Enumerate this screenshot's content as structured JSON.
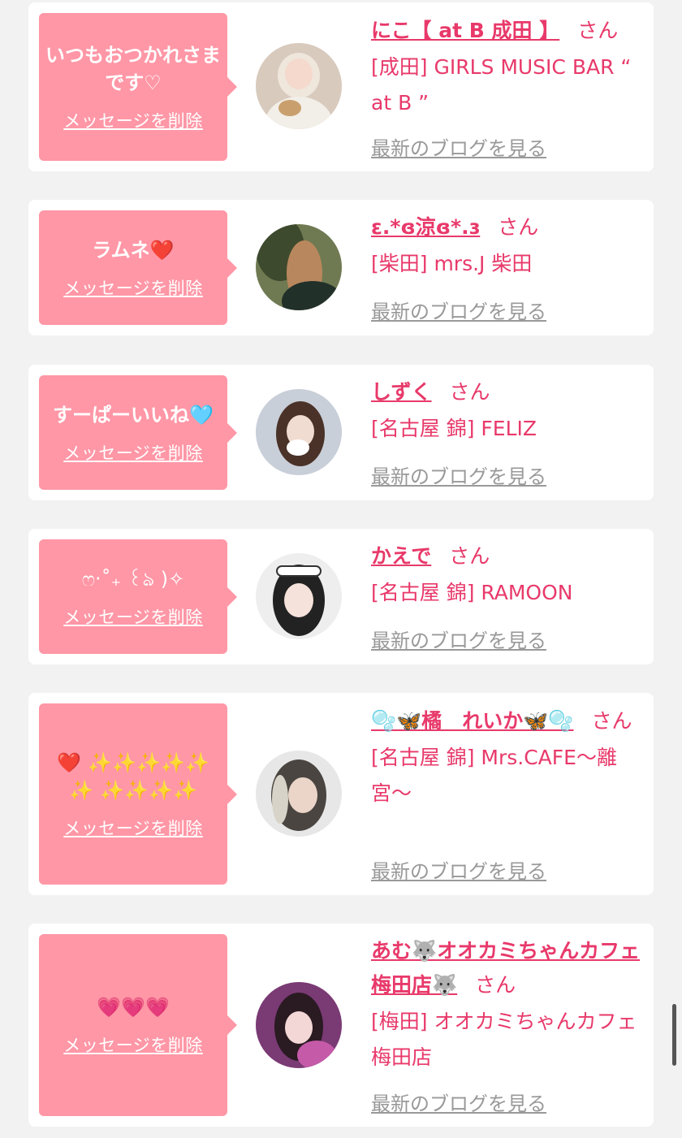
{
  "common": {
    "delete_label": "メッセージを削除",
    "blog_label": "最新のブログを見る",
    "san": "さん"
  },
  "colors": {
    "page_bg": "#f2f2f2",
    "card_bg": "#ffffff",
    "bubble_bg": "#ff97a6",
    "accent": "#e8396a",
    "link_gray": "#999999"
  },
  "items": [
    {
      "message": "いつもおつかれさまです♡",
      "name": "にこ【 at B 成田 】",
      "shop": "[成田] GIRLS MUSIC BAR “ at B ”",
      "avatar_icon": "avatar-photo-icon"
    },
    {
      "message": "ラムネ❤️",
      "name": "ε.*ɞ涼ɞ*.ɜ",
      "shop": "[柴田] mrs.J 柴田",
      "avatar_icon": "avatar-photo-icon"
    },
    {
      "message": "すーぱーいいね🩵",
      "name": "しずく",
      "shop": "[名古屋 錦] FELIZ",
      "avatar_icon": "avatar-photo-icon"
    },
    {
      "message": "ෆ‧˚₊ ꒰ঌ )✧",
      "name": "かえで",
      "shop": "[名古屋 錦] RAMOON",
      "avatar_icon": "avatar-photo-icon"
    },
    {
      "message": "❤️ ✨✨✨✨✨✨ ✨✨✨✨",
      "name": "🫧🦋橘　れいか🦋🫧",
      "shop": "[名古屋 錦] Mrs.CAFE〜離宮〜",
      "avatar_icon": "avatar-photo-icon"
    },
    {
      "message": "💗💗💗",
      "name": "あむ🐺オオカミちゃんカフェ梅田店🐺",
      "shop": "[梅田] オオカミちゃんカフェ梅田店",
      "avatar_icon": "avatar-photo-icon"
    }
  ]
}
